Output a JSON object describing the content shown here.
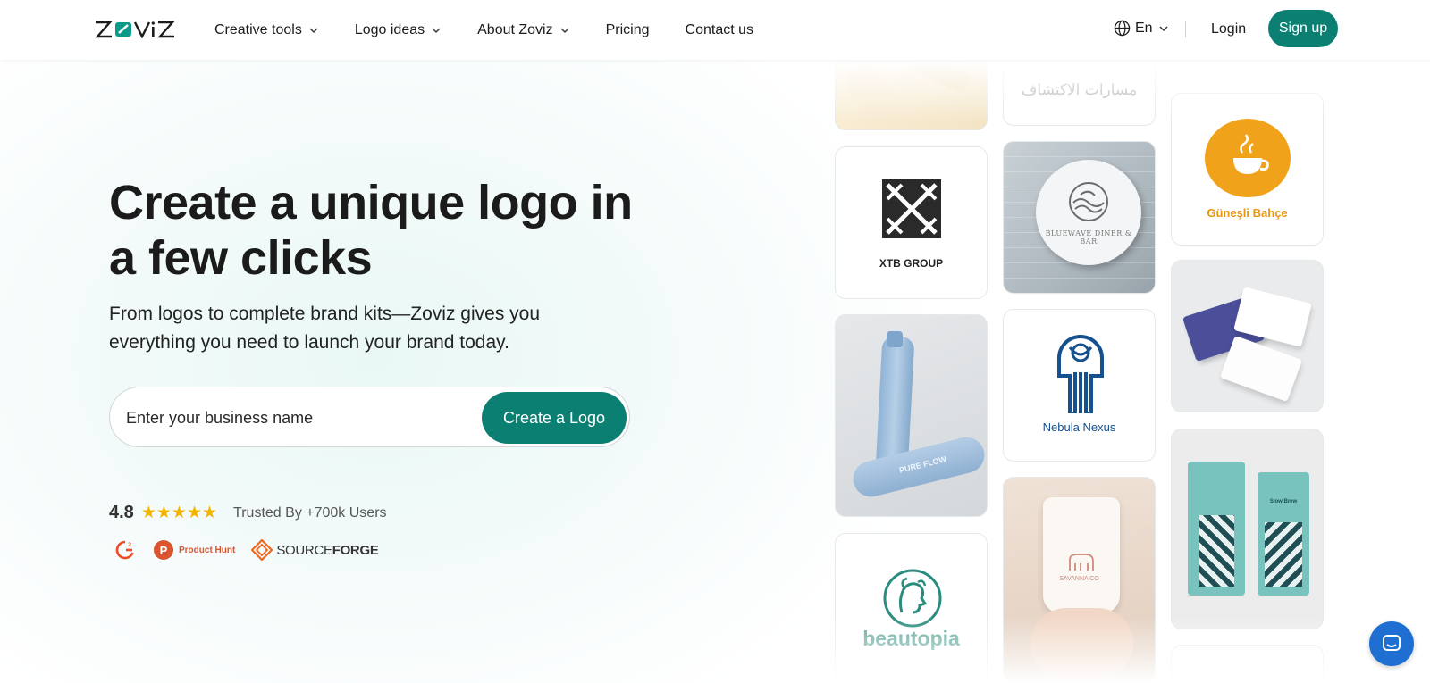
{
  "brand": {
    "name": "ZOVIZ",
    "accent": "#0c7f73"
  },
  "nav": {
    "items": [
      {
        "label": "Creative tools",
        "has_dropdown": true
      },
      {
        "label": "Logo ideas",
        "has_dropdown": true
      },
      {
        "label": "About Zoviz",
        "has_dropdown": true
      },
      {
        "label": "Pricing",
        "has_dropdown": false
      },
      {
        "label": "Contact us",
        "has_dropdown": false
      }
    ],
    "language": "En",
    "login": "Login",
    "signup": "Sign up"
  },
  "hero": {
    "title": "Create a unique logo in a few clicks",
    "subtitle": "From logos to complete brand kits—Zoviz gives you everything you need to launch your brand today.",
    "input_placeholder": "Enter your business name",
    "cta": "Create a Logo",
    "rating": "4.8",
    "stars": 5,
    "trusted": "Trusted By +700k Users",
    "badges": [
      "G2",
      "Product Hunt",
      "SOURCEFORGE"
    ],
    "ph_letter": "P",
    "sf_a": "SOURCE",
    "sf_b": "FORGE"
  },
  "gallery": {
    "arabic": "مسارات الاكتشاف",
    "xtb": "XTB GROUP",
    "bluewave": "BLUEWAVE DINER & BAR",
    "gunesli": "Güneşli Bahçe",
    "pureflow": "PURE FLOW",
    "nebula": "Nebula Nexus",
    "beautopia": "beautopia",
    "savanna": "SAVANNA CO",
    "slowbrew": "Slow Brew"
  },
  "icons": [
    "chevron-down-icon",
    "globe-icon",
    "star-icon",
    "chat-icon"
  ]
}
